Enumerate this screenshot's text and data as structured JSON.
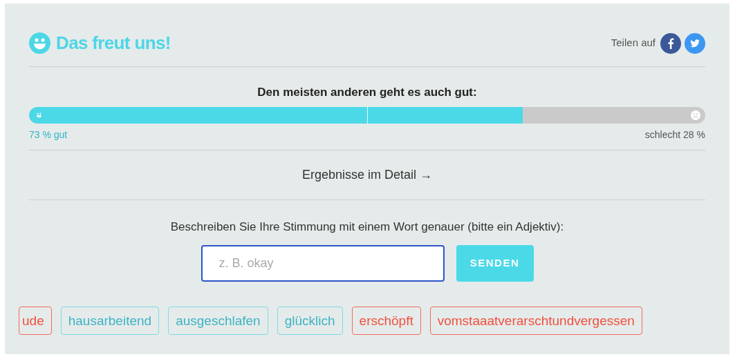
{
  "header": {
    "title": "Das freut uns!",
    "share_label": "Teilen auf"
  },
  "poll": {
    "title": "Den meisten anderen geht es auch gut:",
    "level": 0.73,
    "good_label": "73 % gut",
    "bad_label": "schlecht 28 %"
  },
  "details_link": "Ergebnisse im Detail →",
  "form": {
    "prompt": "Beschreiben Sie Ihre Stimmung mit einem Wort genauer (bitte ein Adjektiv):",
    "placeholder": "z. B. okay",
    "button": "SENDEN"
  },
  "tags": [
    {
      "text": "ude",
      "kind": "bad"
    },
    {
      "text": "hausarbeitend",
      "kind": "good"
    },
    {
      "text": "ausgeschlafen",
      "kind": "good"
    },
    {
      "text": "glücklich",
      "kind": "good"
    },
    {
      "text": "erschöpft",
      "kind": "bad"
    },
    {
      "text": "vomstaaatverarschtundvergessen",
      "kind": "bad"
    }
  ]
}
